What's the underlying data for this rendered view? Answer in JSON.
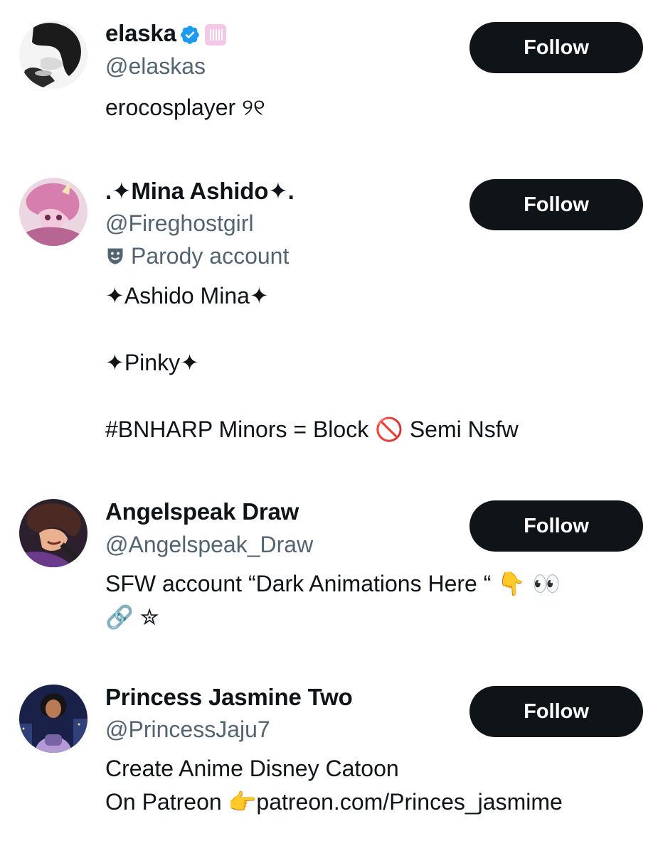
{
  "follow_label": "Follow",
  "users": [
    {
      "name": "elaska",
      "handle": "@elaskas",
      "verified": true,
      "bio": "erocosplayer ୨୧",
      "avatar_colors": [
        "#f2f2f2",
        "#1a1a1a"
      ]
    },
    {
      "name": ".✦Mina Ashido✦.",
      "handle": "@Fireghostgirl",
      "label": "Parody account",
      "bio": "✦Ashido Mina✦\n\n ✦Pinky✦\n\n#BNHARP Minors = Block 🚫 Semi Nsfw",
      "avatar_colors": [
        "#e8c4d8",
        "#c77aa6"
      ]
    },
    {
      "name": "Angelspeak Draw",
      "handle": "@Angelspeak_Draw",
      "bio": "SFW account “Dark Animations Here “ 👇 👀\n🔗 ✮",
      "avatar_colors": [
        "#3b2a3a",
        "#e8b08c"
      ]
    },
    {
      "name": "Princess Jasmine Two",
      "handle": "@PrincessJaju7",
      "bio": "Create Anime Disney Catoon\nOn Patreon 👉patreon.com/Princes_jasmime",
      "avatar_colors": [
        "#1c2550",
        "#a98cc9"
      ]
    }
  ]
}
